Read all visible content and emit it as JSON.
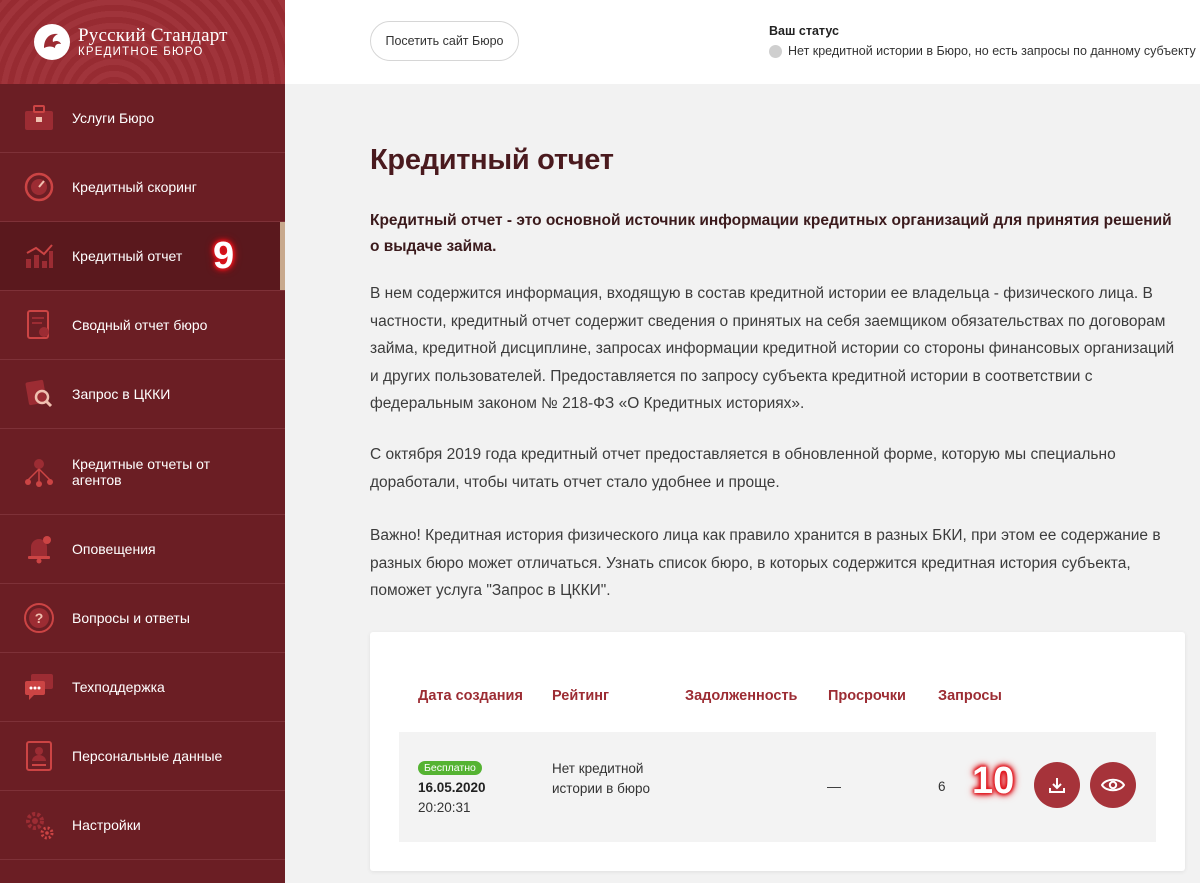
{
  "brand": {
    "title": "Русский Стандарт",
    "subtitle": "Кредитное бюро"
  },
  "colors": {
    "sidebar": "#6b1e24",
    "logo_bg": "#9c2c33",
    "accent": "#a6333a",
    "badge": "#55b332"
  },
  "sidebar": {
    "items": [
      {
        "label": "Услуги Бюро",
        "icon": "briefcase-icon"
      },
      {
        "label": "Кредитный скоринг",
        "icon": "gauge-icon"
      },
      {
        "label": "Кредитный отчет",
        "icon": "chart-icon",
        "active": true
      },
      {
        "label": "Сводный отчет бюро",
        "icon": "document-icon"
      },
      {
        "label": "Запрос в ЦККИ",
        "icon": "search-document-icon"
      },
      {
        "label": "Кредитные отчеты от агентов",
        "icon": "network-icon"
      },
      {
        "label": "Оповещения",
        "icon": "bell-icon"
      },
      {
        "label": "Вопросы и ответы",
        "icon": "question-icon"
      },
      {
        "label": "Техподдержка",
        "icon": "chat-icon"
      },
      {
        "label": "Персональные данные",
        "icon": "person-card-icon"
      },
      {
        "label": "Настройки",
        "icon": "gear-icon"
      }
    ]
  },
  "annotations": {
    "marker_sidebar": "9",
    "marker_download": "10"
  },
  "topbar": {
    "visit_button": "Посетить сайт Бюро",
    "status_title": "Ваш статус",
    "status_text": "Нет кредитной истории в Бюро, но есть запросы по данному субъекту"
  },
  "main": {
    "title": "Кредитный отчет",
    "lead": "Кредитный отчет - это основной источник информации кредитных организаций для принятия решений о выдаче займа.",
    "paragraph1": "В нем содержится информация, входящую в состав кредитной истории ее владельца - физического лица. В частности, кредитный отчет содержит сведения о принятых на себя заемщиком обязательствах по договорам займа, кредитной дисциплине, запросах информации кредитной истории со стороны финансовых организаций и других пользователей. Предоставляется по запросу субъекта кредитной истории в соответствии с федеральным законом № 218-ФЗ «О Кредитных историях».",
    "paragraph2": "С октября 2019 года кредитный отчет предоставляется в обновленной форме, которую мы специально доработали, чтобы читать отчет стало удобнее и проще.",
    "paragraph3": "Важно! Кредитная история физического лица как правило хранится в разных БКИ, при этом ее содержание в разных бюро может отличаться. Узнать список бюро, в которых содержится кредитная история субъекта, поможет услуга \"Запрос в ЦККИ\"."
  },
  "table": {
    "headers": [
      "Дата создания",
      "Рейтинг",
      "Задолженность",
      "Просрочки",
      "Запросы"
    ],
    "row": {
      "badge": "Бесплатно",
      "date": "16.05.2020",
      "time": "20:20:31",
      "rating": "Нет кредитной истории в бюро",
      "debt": "",
      "overdue": "—",
      "requests": "6"
    }
  }
}
